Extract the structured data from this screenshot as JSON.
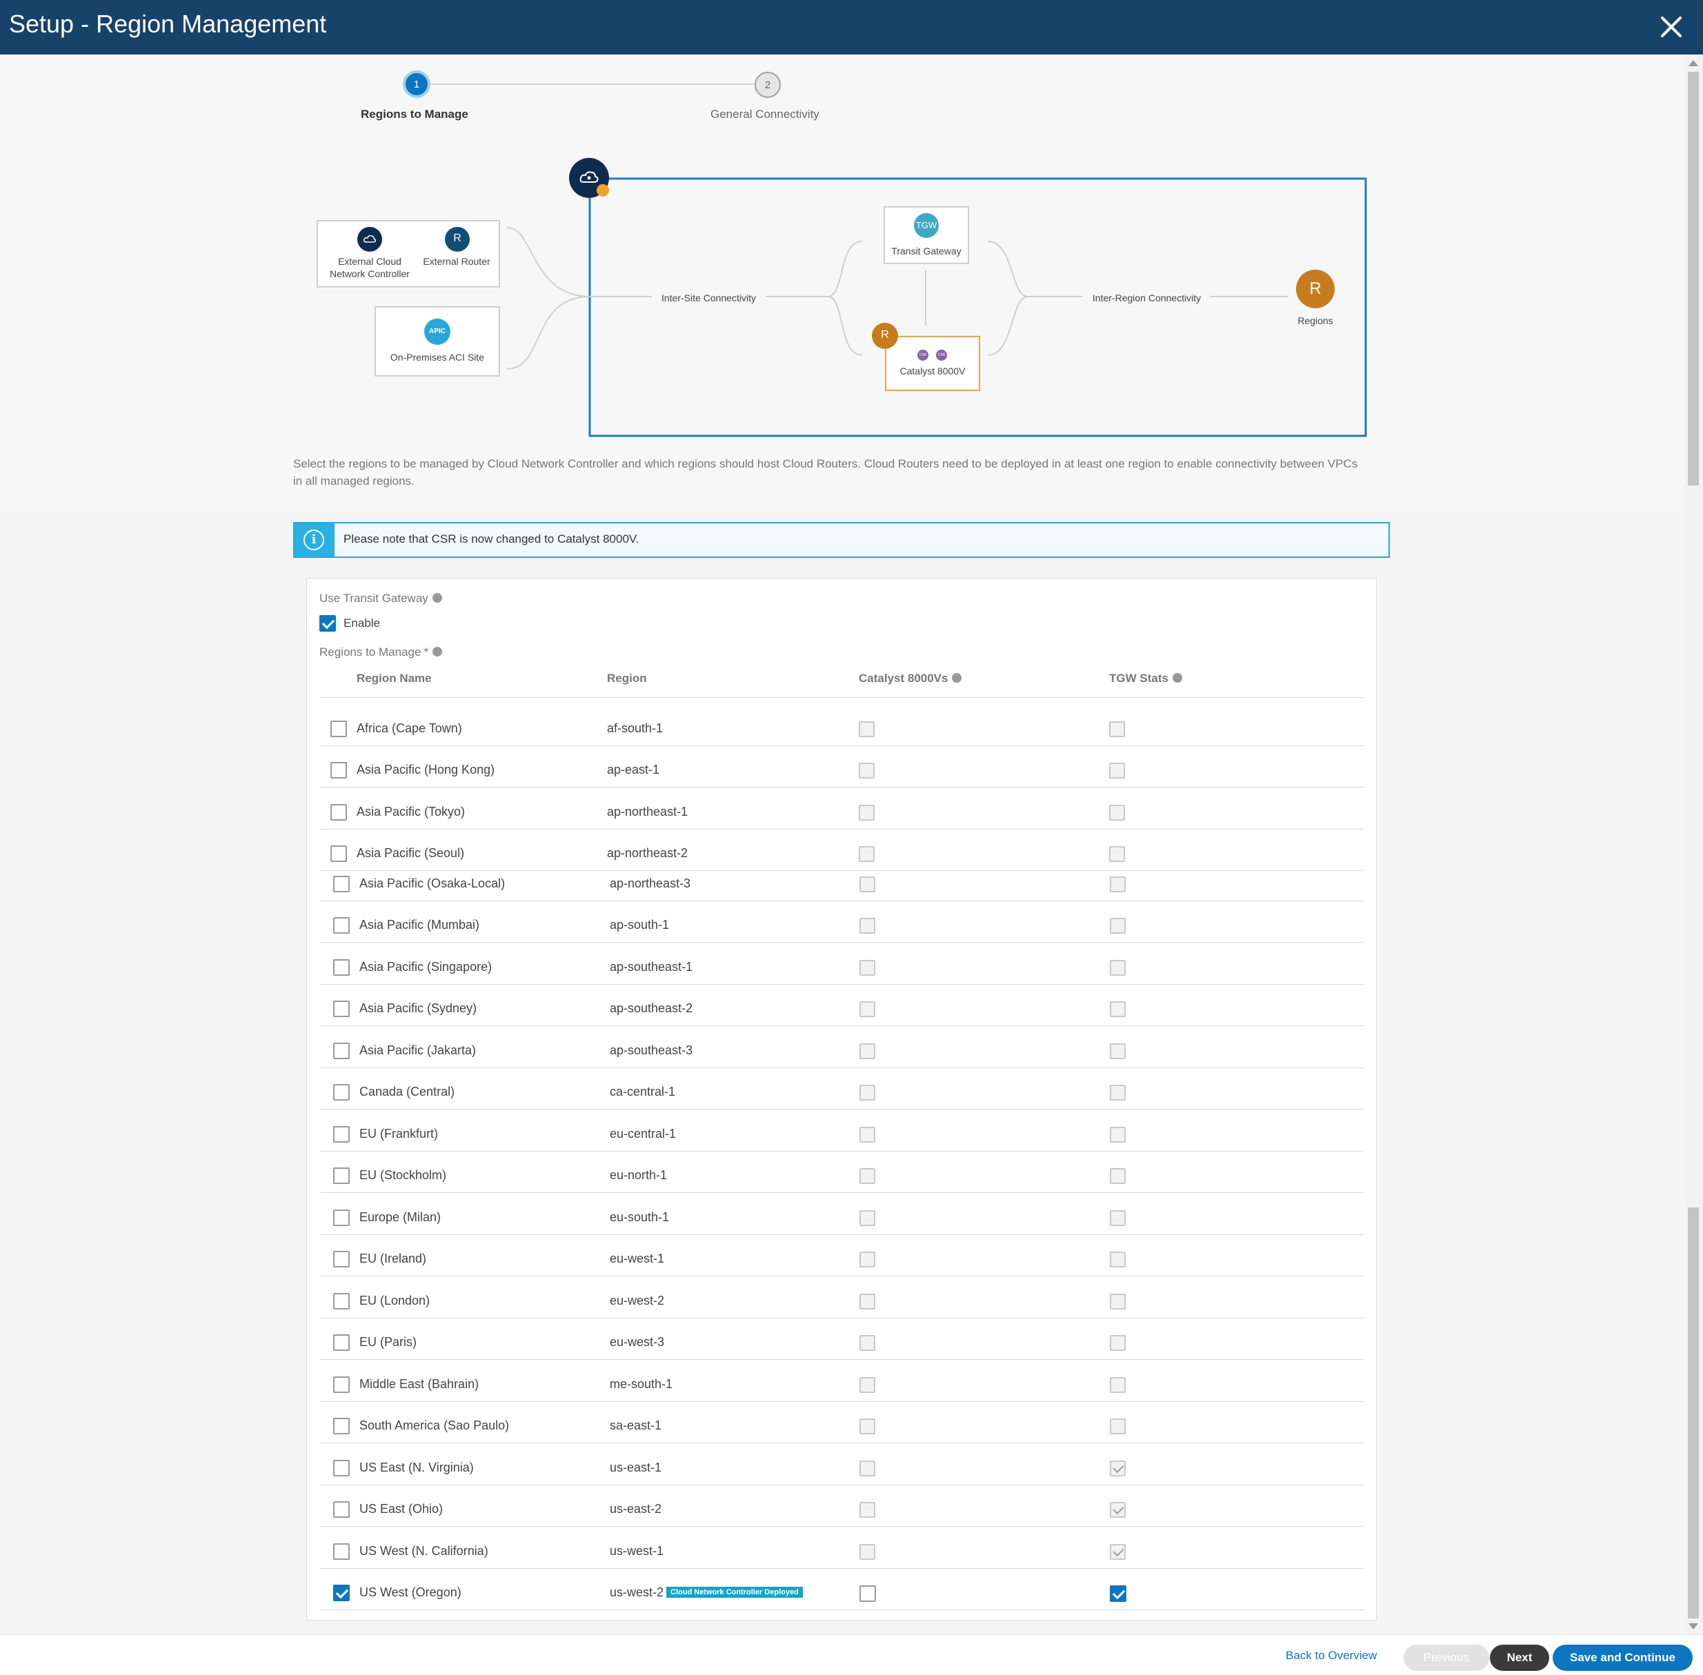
{
  "header": {
    "title": "Setup - Region Management"
  },
  "steps": [
    {
      "number": "1",
      "label": "Regions to Manage"
    },
    {
      "number": "2",
      "label": "General Connectivity"
    }
  ],
  "diagram": {
    "external_cloud_label": "External Cloud Network Controller",
    "external_router_label": "External Router",
    "router_initial": "R",
    "onprem_label": "On-Premises ACI Site",
    "apic_text": "APIC",
    "intersite_label": "Inter-Site Connectivity",
    "tgw_text": "TGW",
    "transit_gateway_label": "Transit Gateway",
    "catalyst_label": "Catalyst 8000V",
    "csr_text": "CSR",
    "interregion_label": "Inter-Region Connectivity",
    "regions_label": "Regions"
  },
  "description": "Select the regions to be managed by Cloud Network Controller and which regions should host Cloud Routers. Cloud Routers need to be deployed in at least one region to enable connectivity between VPCs in all managed regions.",
  "notice": {
    "text": "Please note that CSR is now changed to Catalyst 8000V."
  },
  "form": {
    "tgw_label": "Use Transit Gateway",
    "enable_label": "Enable",
    "enable_checked": true,
    "regions_label": "Regions to Manage",
    "required_mark": "*"
  },
  "table": {
    "headers": [
      "Region Name",
      "Region",
      "Catalyst 8000Vs",
      "TGW Stats"
    ],
    "rows": [
      {
        "name": "Africa (Cape Town)",
        "region": "af-south-1",
        "selected": false,
        "catalyst": false,
        "tgw": false
      },
      {
        "name": "Asia Pacific (Hong Kong)",
        "region": "ap-east-1",
        "selected": false,
        "catalyst": false,
        "tgw": false
      },
      {
        "name": "Asia Pacific (Tokyo)",
        "region": "ap-northeast-1",
        "selected": false,
        "catalyst": false,
        "tgw": false
      },
      {
        "name": "Asia Pacific (Seoul)",
        "region": "ap-northeast-2",
        "selected": false,
        "catalyst": false,
        "tgw": false
      },
      {
        "name": "Asia Pacific (Osaka-Local)",
        "region": "ap-northeast-3",
        "selected": false,
        "catalyst": false,
        "tgw": false
      },
      {
        "name": "Asia Pacific (Mumbai)",
        "region": "ap-south-1",
        "selected": false,
        "catalyst": false,
        "tgw": false
      },
      {
        "name": "Asia Pacific (Singapore)",
        "region": "ap-southeast-1",
        "selected": false,
        "catalyst": false,
        "tgw": false
      },
      {
        "name": "Asia Pacific (Sydney)",
        "region": "ap-southeast-2",
        "selected": false,
        "catalyst": false,
        "tgw": false
      },
      {
        "name": "Asia Pacific (Jakarta)",
        "region": "ap-southeast-3",
        "selected": false,
        "catalyst": false,
        "tgw": false
      },
      {
        "name": "Canada (Central)",
        "region": "ca-central-1",
        "selected": false,
        "catalyst": false,
        "tgw": false
      },
      {
        "name": "EU (Frankfurt)",
        "region": "eu-central-1",
        "selected": false,
        "catalyst": false,
        "tgw": false
      },
      {
        "name": "EU (Stockholm)",
        "region": "eu-north-1",
        "selected": false,
        "catalyst": false,
        "tgw": false
      },
      {
        "name": "Europe (Milan)",
        "region": "eu-south-1",
        "selected": false,
        "catalyst": false,
        "tgw": false
      },
      {
        "name": "EU (Ireland)",
        "region": "eu-west-1",
        "selected": false,
        "catalyst": false,
        "tgw": false
      },
      {
        "name": "EU (London)",
        "region": "eu-west-2",
        "selected": false,
        "catalyst": false,
        "tgw": false
      },
      {
        "name": "EU (Paris)",
        "region": "eu-west-3",
        "selected": false,
        "catalyst": false,
        "tgw": false
      },
      {
        "name": "Middle East (Bahrain)",
        "region": "me-south-1",
        "selected": false,
        "catalyst": false,
        "tgw": false
      },
      {
        "name": "South America (Sao Paulo)",
        "region": "sa-east-1",
        "selected": false,
        "catalyst": false,
        "tgw": false
      },
      {
        "name": "US East (N. Virginia)",
        "region": "us-east-1",
        "selected": false,
        "catalyst": false,
        "tgw": true
      },
      {
        "name": "US East (Ohio)",
        "region": "us-east-2",
        "selected": false,
        "catalyst": false,
        "tgw": true
      },
      {
        "name": "US West (N. California)",
        "region": "us-west-1",
        "selected": false,
        "catalyst": false,
        "tgw": true
      },
      {
        "name": "US West (Oregon)",
        "region": "us-west-2",
        "badge": "Cloud Network Controller Deployed",
        "selected": true,
        "catalyst": false,
        "tgw": true
      }
    ]
  },
  "footer": {
    "back_label": "Back to Overview",
    "previous_label": "Previous",
    "next_label": "Next",
    "save_label": "Save and Continue"
  },
  "colors": {
    "header_bg": "#17426a",
    "accent": "#0d76c1",
    "router_orange": "#c77d1d",
    "notice_blue": "#2ab0e1",
    "badge_teal": "#12a4c9"
  }
}
